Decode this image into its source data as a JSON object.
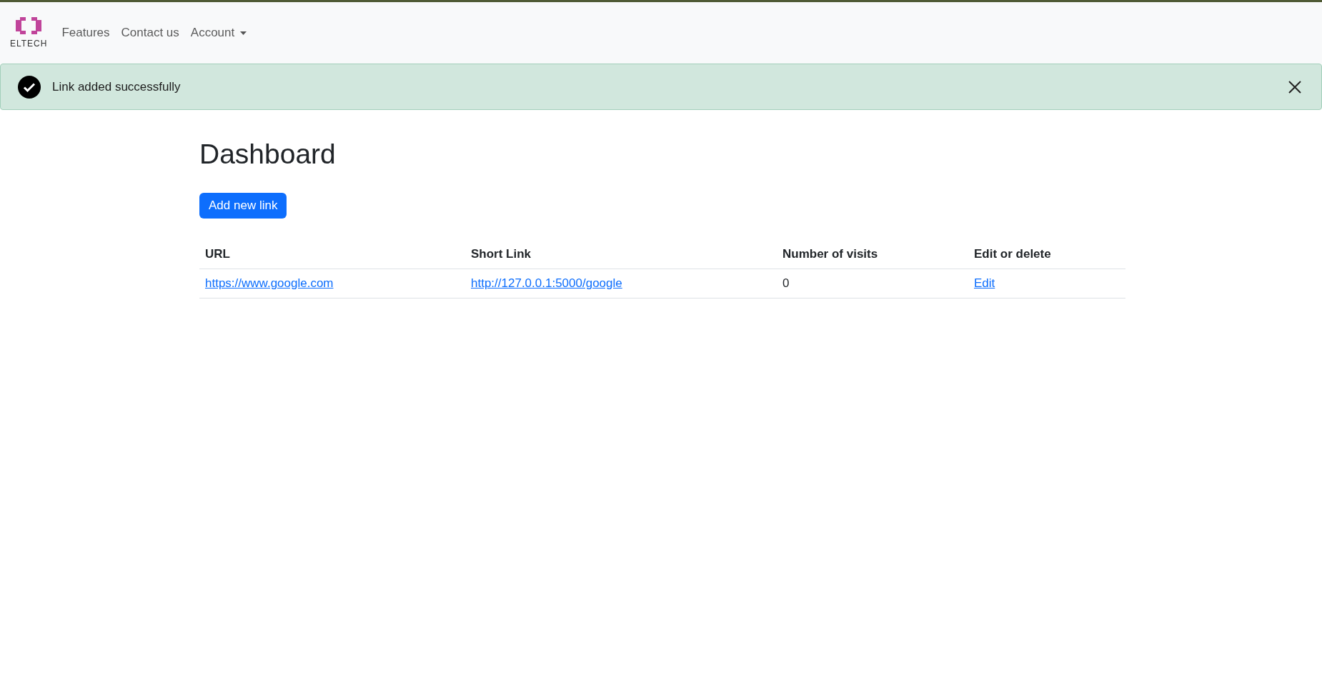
{
  "navbar": {
    "logo_text": "ELTECH",
    "items": [
      {
        "label": "Features",
        "kind": "link"
      },
      {
        "label": "Contact us",
        "kind": "link"
      },
      {
        "label": "Account",
        "kind": "dropdown"
      }
    ]
  },
  "alert": {
    "kind": "success",
    "message": "Link added successfully"
  },
  "title": "Dashboard",
  "add_button": "Add new link",
  "table": {
    "columns": [
      "URL",
      "Short Link",
      "Number of visits",
      "Edit or delete"
    ],
    "rows": [
      {
        "url": "https://www.google.com",
        "short_link": "http://127.0.0.1:5000/google",
        "visits": "0",
        "action": "Edit"
      }
    ]
  }
}
